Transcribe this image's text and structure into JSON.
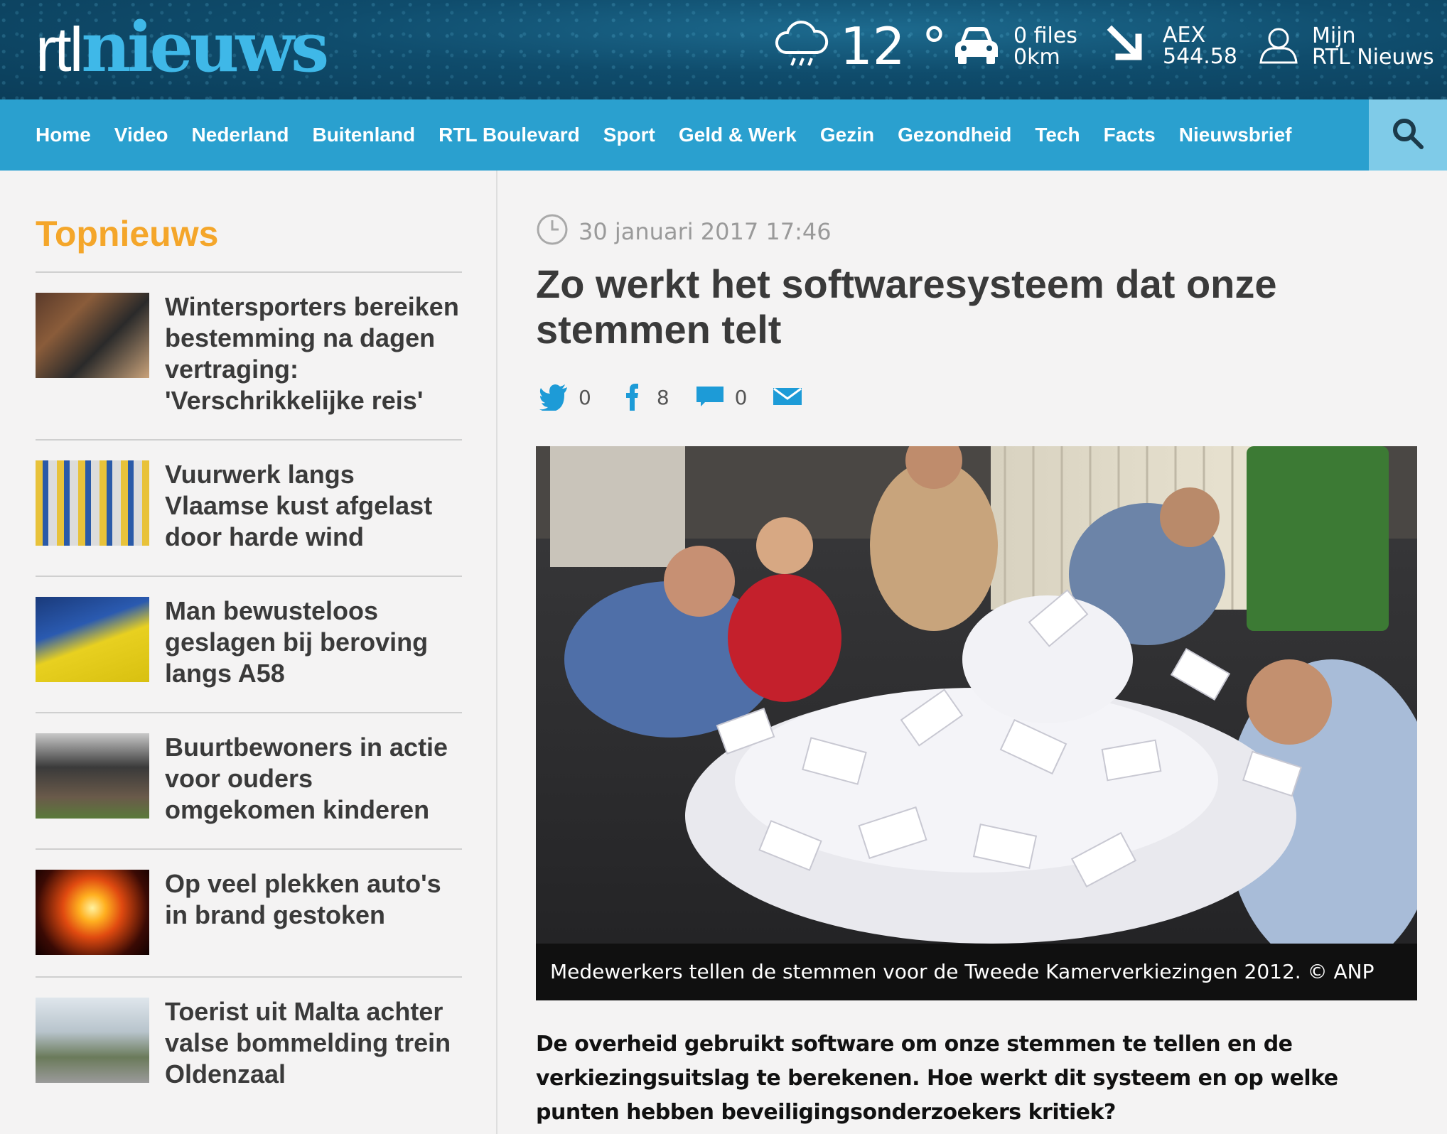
{
  "header": {
    "logo_rtl": "rtl",
    "logo_nieuws": "nieuws",
    "weather": {
      "icon": "rain-cloud-icon",
      "temperature": "12 °"
    },
    "traffic": {
      "icon": "car-icon",
      "line1": "0 files",
      "line2": "0km"
    },
    "aex": {
      "icon": "arrow-down-right-icon",
      "line1": "AEX",
      "line2": "544.58"
    },
    "account": {
      "icon": "user-icon",
      "line1": "Mijn",
      "line2": "RTL Nieuws"
    }
  },
  "nav": {
    "items": [
      "Home",
      "Video",
      "Nederland",
      "Buitenland",
      "RTL Boulevard",
      "Sport",
      "Geld & Werk",
      "Gezin",
      "Gezondheid",
      "Tech",
      "Facts",
      "Nieuwsbrief"
    ],
    "search_icon": "search-icon"
  },
  "sidebar": {
    "title": "Topnieuws",
    "items": [
      {
        "title": "Wintersporters bereiken bestemming na dagen vertraging: 'Verschrikkelijke reis'"
      },
      {
        "title": "Vuurwerk langs Vlaamse kust afgelast door harde wind"
      },
      {
        "title": "Man bewusteloos geslagen bij beroving langs A58"
      },
      {
        "title": "Buurtbewoners in actie voor ouders omgekomen kinderen"
      },
      {
        "title": "Op veel plekken auto's in brand gestoken"
      },
      {
        "title": "Toerist uit Malta achter valse bommelding trein Oldenzaal"
      }
    ]
  },
  "article": {
    "date": "30 januari 2017 17:46",
    "headline": "Zo werkt het softwaresysteem dat onze stemmen telt",
    "share": {
      "twitter_count": "0",
      "facebook_count": "8",
      "comments_count": "0"
    },
    "caption": "Medewerkers tellen de stemmen voor de Tweede Kamerverkiezingen 2012. © ANP",
    "lead": "De overheid gebruikt software om onze stemmen te tellen en de verkiezingsuitslag te berekenen. Hoe werkt dit systeem en op welke punten hebben beveiligingsonderzoekers kritiek?"
  },
  "colors": {
    "header_bg": "#0f4c6c",
    "nav_bg": "#2aa0cf",
    "search_bg": "#7fcbe8",
    "logo_accent": "#3fb8e8",
    "topnieuws_accent": "#f4a62a"
  }
}
